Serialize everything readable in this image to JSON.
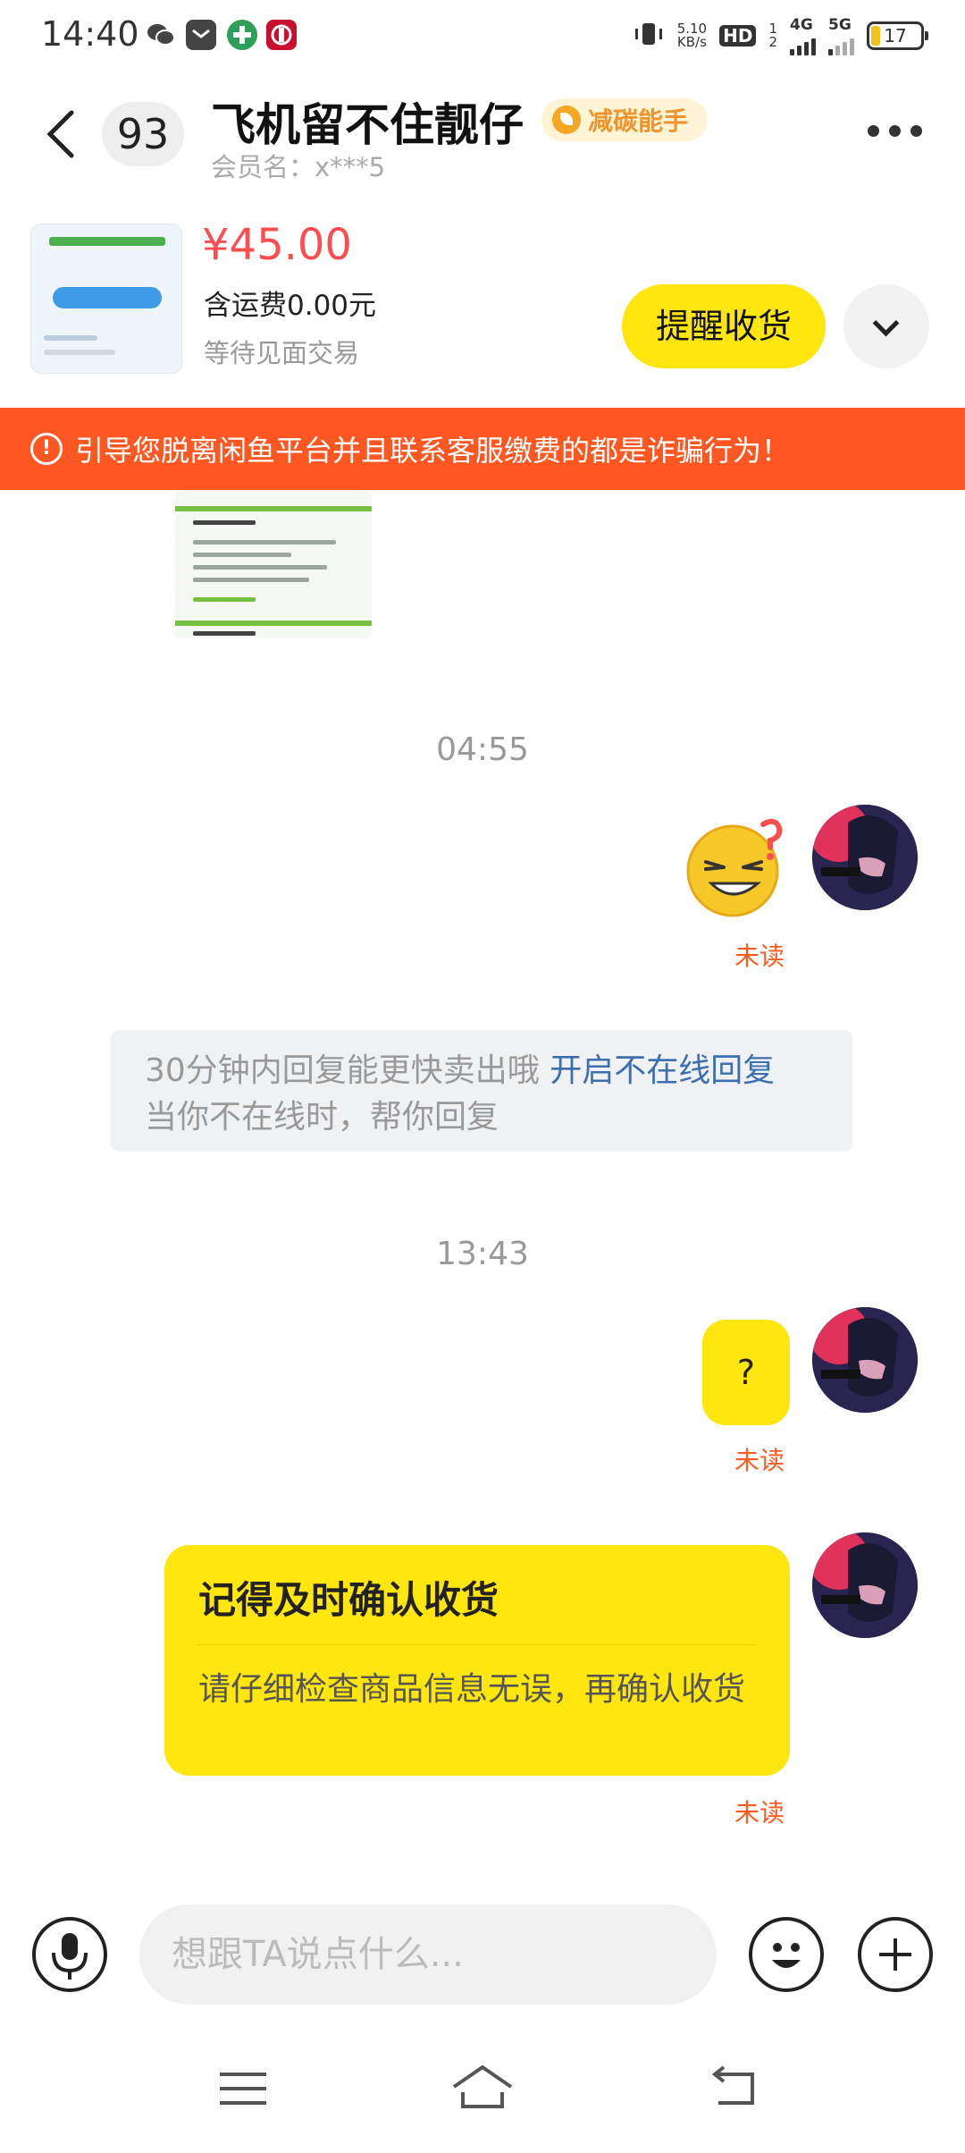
{
  "status_bar": {
    "time": "14:40",
    "net_speed_value": "5.10",
    "net_speed_unit": "KB/s",
    "hd_label": "HD",
    "sim1": "1",
    "sim2": "2",
    "net1": "4G",
    "net2": "5G",
    "battery": "17"
  },
  "header": {
    "back_icon": "chevron-left-icon",
    "unread_count": "93",
    "peer_name": "飞机留不住靓仔",
    "badge": "减碳能手",
    "member_name": "会员名：x***5",
    "more_icon": "more-dots-icon"
  },
  "product": {
    "price": "¥45.00",
    "shipping": "含运费0.00元",
    "status": "等待见面交易",
    "remind_button": "提醒收货",
    "expand_icon": "chevron-down-icon"
  },
  "warning": {
    "text": "引导您脱离闲鱼平台并且联系客服缴费的都是诈骗行为！",
    "icon": "!"
  },
  "messages": {
    "time1": "04:55",
    "unread_label": "未读",
    "system_tip_text": "30分钟内回复能更快卖出哦 ",
    "system_tip_link": "开启不在线回复",
    "system_tip_line2": "当你不在线时，帮你回复",
    "time2": "13:43",
    "question_text": "?",
    "card_title": "记得及时确认收货",
    "card_body": "请仔细检查商品信息无误，再确认收货"
  },
  "input": {
    "placeholder": "想跟TA说点什么..."
  },
  "colors": {
    "accent_yellow": "#ffe60f",
    "warning_orange": "#ff5722",
    "price_red": "#ff4d4f",
    "unread_orange": "#ff5a1f",
    "link_blue": "#3d6fb0"
  }
}
